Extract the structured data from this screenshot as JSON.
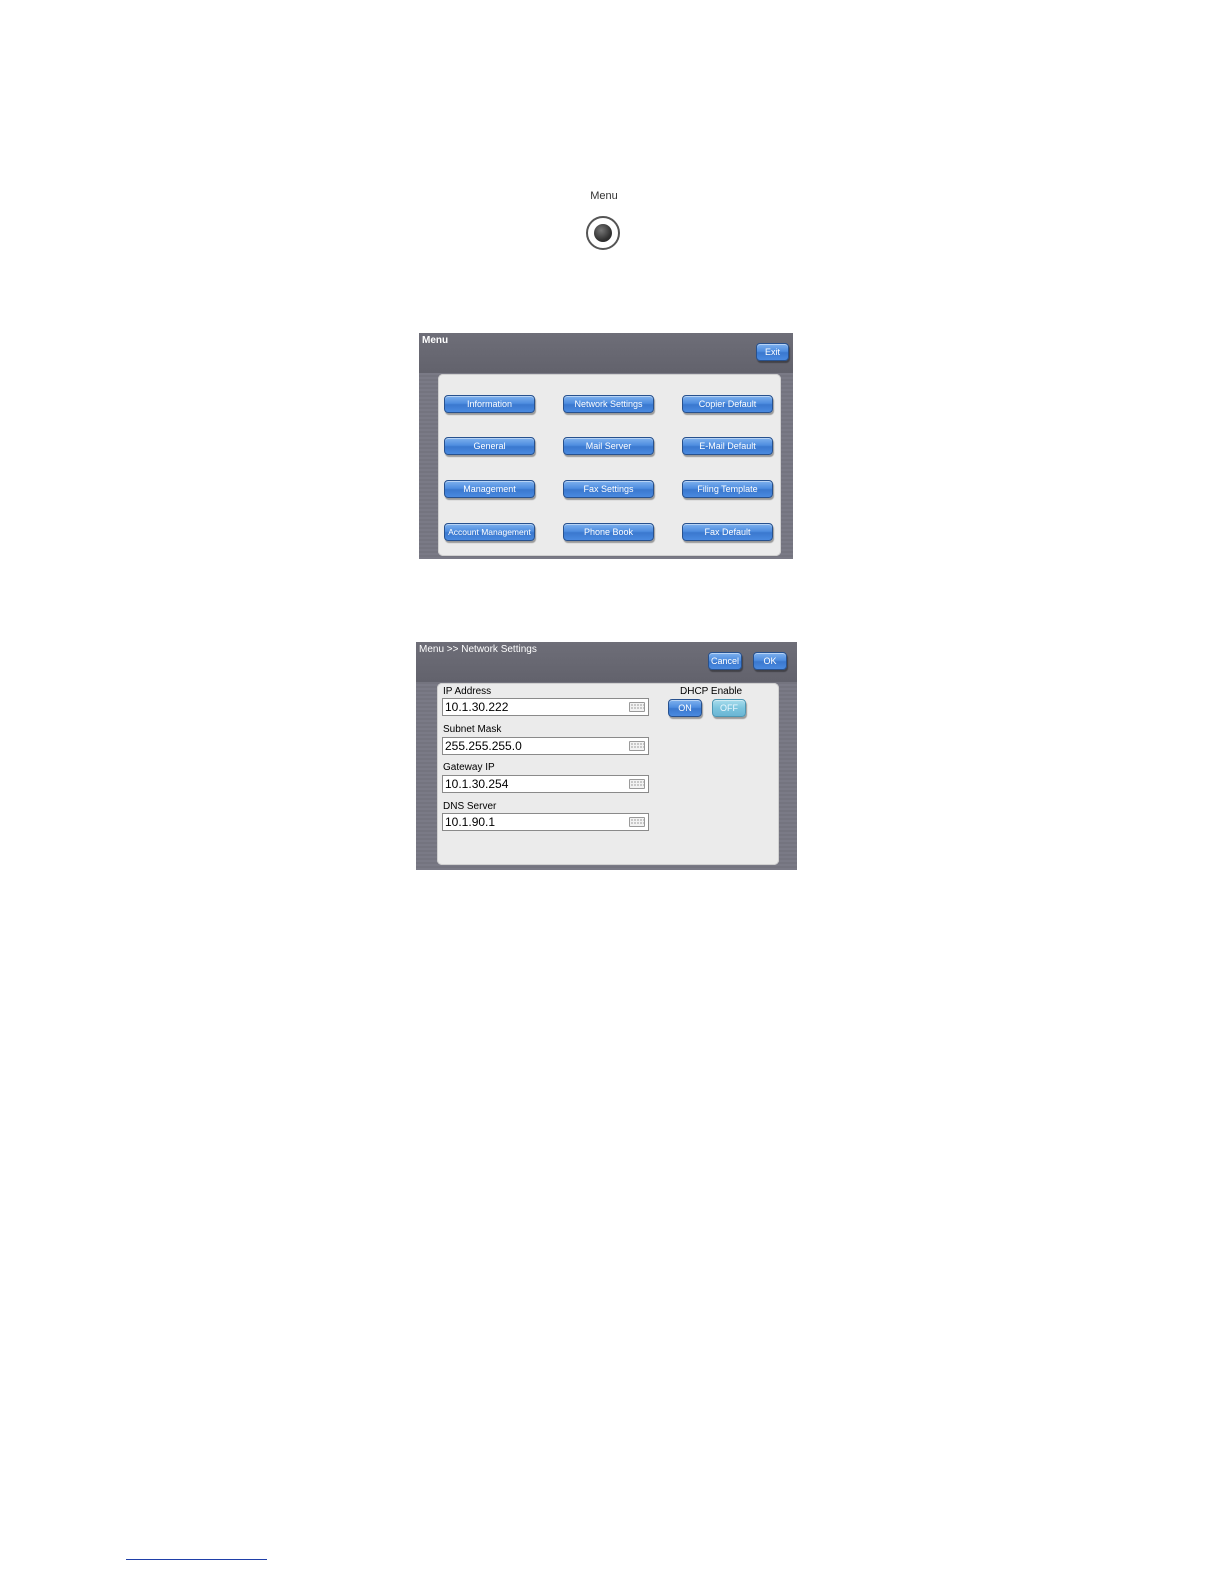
{
  "menu_key": {
    "label": "Menu",
    "icon": "round-button-icon"
  },
  "menu_screen": {
    "title": "Menu",
    "exit_label": "Exit",
    "buttons": [
      "Information",
      "Network Settings",
      "Copier Default",
      "General",
      "Mail Server",
      "E-Mail Default",
      "Management",
      "Fax Settings",
      "Filing Template",
      "Account Management",
      "Phone Book",
      "Fax Default"
    ]
  },
  "network_screen": {
    "breadcrumb": "Menu >> Network Settings",
    "cancel_label": "Cancel",
    "ok_label": "OK",
    "fields": [
      {
        "label": "IP Address",
        "value": "10.1.30.222"
      },
      {
        "label": "Subnet Mask",
        "value": "255.255.255.0"
      },
      {
        "label": "Gateway IP",
        "value": "10.1.30.254"
      },
      {
        "label": "DNS Server",
        "value": "10.1.90.1"
      }
    ],
    "dhcp": {
      "label": "DHCP Enable",
      "on_label": "ON",
      "off_label": "OFF",
      "selected": "OFF"
    }
  }
}
